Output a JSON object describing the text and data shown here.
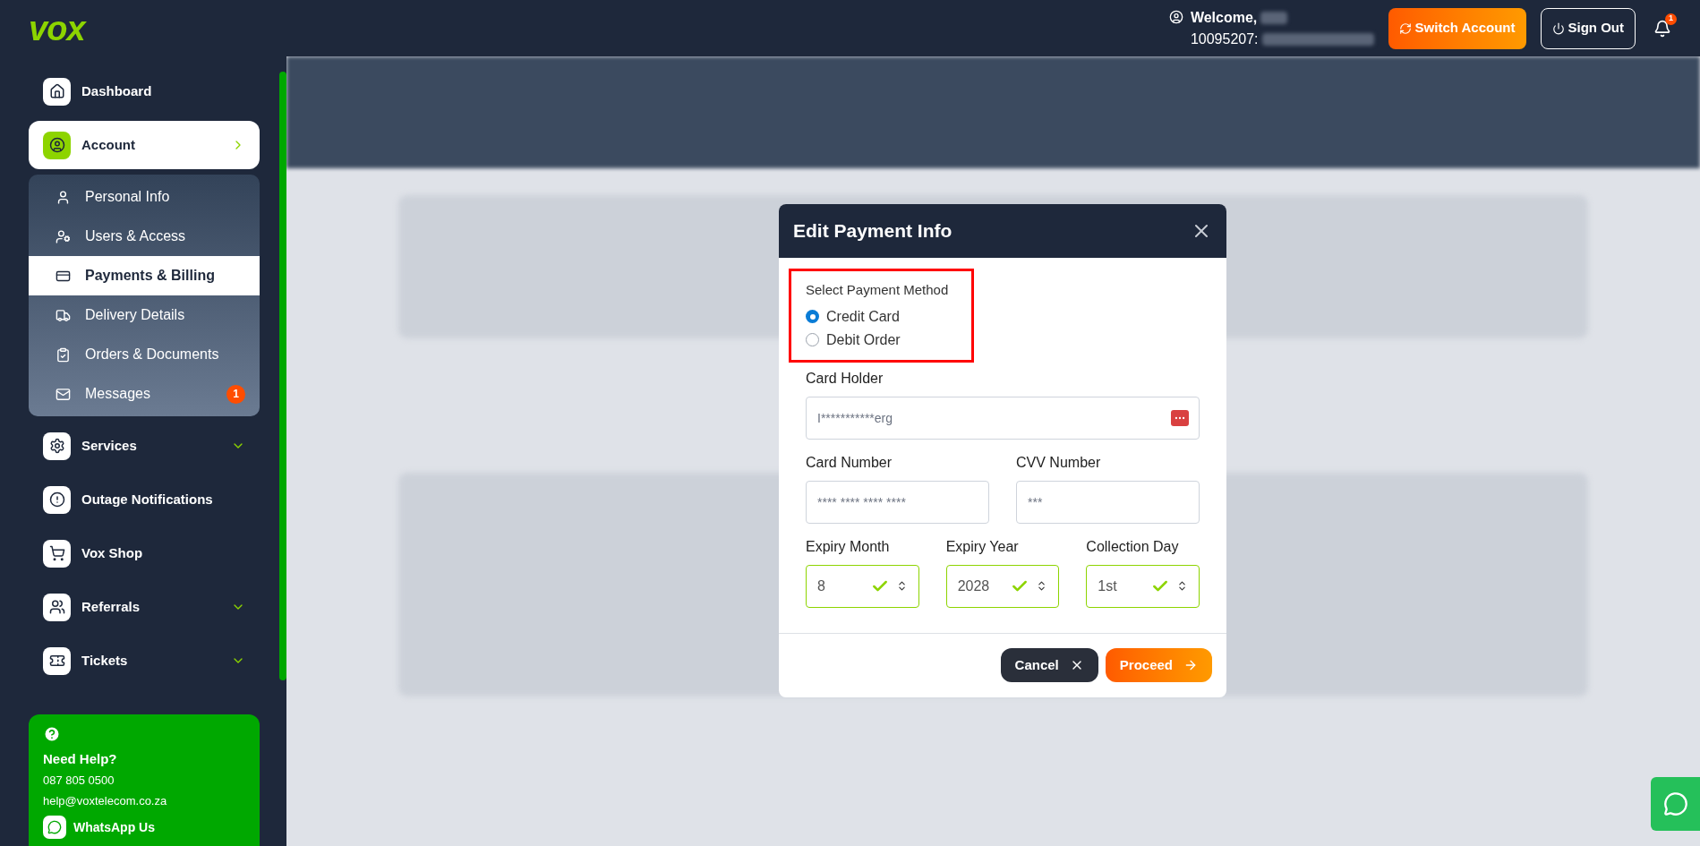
{
  "header": {
    "logo": "vox",
    "welcome": "Welcome,",
    "account": "10095207:",
    "switch_button": "Switch Account",
    "signout_button": "Sign Out",
    "notification_count": "1"
  },
  "sidebar": {
    "items": [
      {
        "label": "Dashboard",
        "kind": "link",
        "selected": false
      },
      {
        "label": "Account",
        "kind": "group",
        "selected": true,
        "expanded": true,
        "children": [
          {
            "label": "Personal Info",
            "selected": false
          },
          {
            "label": "Users & Access",
            "selected": false
          },
          {
            "label": "Payments & Billing",
            "selected": true
          },
          {
            "label": "Delivery Details",
            "selected": false
          },
          {
            "label": "Orders & Documents",
            "selected": false
          },
          {
            "label": "Messages",
            "selected": false,
            "badge": "1"
          }
        ]
      },
      {
        "label": "Services",
        "kind": "group",
        "selected": false,
        "expanded": false
      },
      {
        "label": "Outage Notifications",
        "kind": "link",
        "selected": false
      },
      {
        "label": "Vox Shop",
        "kind": "link",
        "selected": false
      },
      {
        "label": "Referrals",
        "kind": "group",
        "selected": false,
        "expanded": false
      },
      {
        "label": "Tickets",
        "kind": "group",
        "selected": false,
        "expanded": false
      }
    ],
    "help": {
      "title": "Need Help?",
      "phone": "087 805 0500",
      "email": "help@voxtelecom.co.za",
      "whatsapp": "WhatsApp Us"
    }
  },
  "modal": {
    "title": "Edit Payment Info",
    "method": {
      "label": "Select Payment Method",
      "options": [
        {
          "label": "Credit Card",
          "selected": true
        },
        {
          "label": "Debit Order",
          "selected": false
        }
      ]
    },
    "card_holder": {
      "label": "Card Holder",
      "placeholder": "I***********erg"
    },
    "card_number": {
      "label": "Card Number",
      "placeholder": "**** **** **** ****"
    },
    "cvv": {
      "label": "CVV Number",
      "placeholder": "***"
    },
    "selects": [
      {
        "label": "Expiry Month",
        "value": "8",
        "valid": true
      },
      {
        "label": "Expiry Year",
        "value": "2028",
        "valid": true
      },
      {
        "label": "Collection Day",
        "value": "1st",
        "valid": true
      }
    ],
    "cancel_button": "Cancel",
    "proceed_button": "Proceed"
  }
}
